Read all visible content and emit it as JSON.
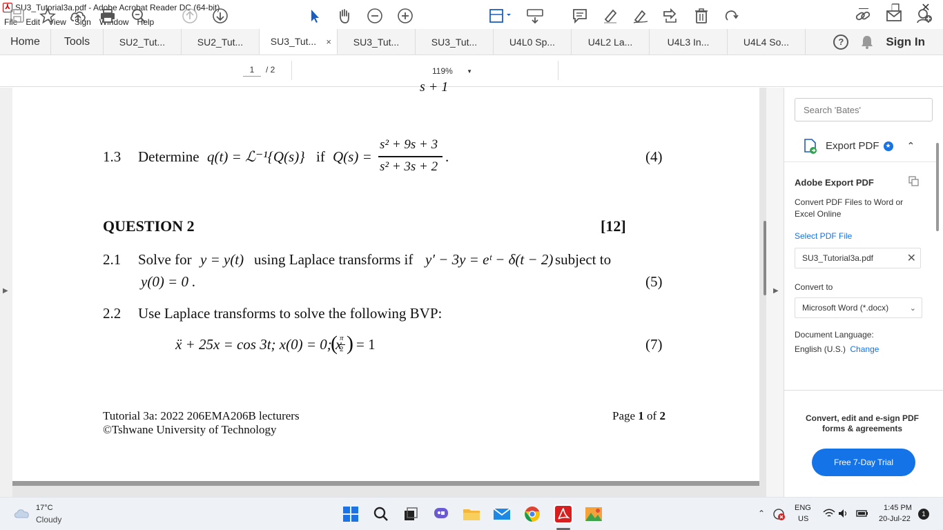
{
  "window": {
    "title": "SU3_Tutorial3a.pdf - Adobe Acrobat Reader DC (64-bit)",
    "icon": "acrobat-icon"
  },
  "menu": [
    "File",
    "Edit",
    "View",
    "Sign",
    "Window",
    "Help"
  ],
  "tabs": {
    "home": "Home",
    "tools": "Tools",
    "docs": [
      "SU2_Tut...",
      "SU2_Tut...",
      "SU3_Tut...",
      "SU3_Tut...",
      "SU3_Tut...",
      "U4L0 Sp...",
      "U4L2 La...",
      "U4L3 In...",
      "U4L4 So..."
    ],
    "active_index": 2,
    "close": "×",
    "sign_in": "Sign In",
    "help": "?"
  },
  "toolbar": {
    "page_current": "1",
    "page_total": "/ 2",
    "zoom": "119%"
  },
  "document": {
    "top_fragment": "s + 1",
    "q13": {
      "num": "1.3",
      "text": "Determine",
      "eq": "q(t) = ℒ⁻¹{Q(s)}",
      "if": "if",
      "lhs": "Q(s) =",
      "numerator": "s² + 9s + 3",
      "denominator": "s² + 3s + 2",
      "end": ".",
      "marks": "(4)"
    },
    "question2": {
      "heading": "QUESTION 2",
      "total": "[12]"
    },
    "q21": {
      "num": "2.1",
      "text": "Solve for",
      "eq1": "y = y(t)",
      "text2": "using Laplace transforms if",
      "eq2": "y′ − 3y = eᵗ − δ(t − 2)",
      "text3": "subject to",
      "line2": "y(0) = 0 .",
      "marks": "(5)"
    },
    "q22": {
      "num": "2.2",
      "text": "Use Laplace transforms to solve the following BVP:",
      "eq": "ẍ + 25x = cos 3t; x(0) = 0; x",
      "eq_paren_num": "π",
      "eq_paren_den": "2",
      "eq_end": "= 1",
      "marks": "(7)"
    },
    "footer": {
      "left1": "Tutorial 3a: 2022 206EMA206B lecturers",
      "left2": "©Tshwane University of Technology",
      "page_prefix": "Page",
      "page_num": "1",
      "page_of": "of",
      "page_total": "2"
    }
  },
  "right_pane": {
    "search_placeholder": "Search 'Bates'",
    "export_title": "Export PDF",
    "section_title": "Adobe Export PDF",
    "description": "Convert PDF Files to Word or Excel Online",
    "select_link": "Select PDF File",
    "file_name": "SU3_Tutorial3a.pdf",
    "convert_to_label": "Convert to",
    "convert_to_value": "Microsoft Word (*.docx)",
    "doc_lang_label": "Document Language:",
    "doc_lang_value": "English (U.S.)",
    "change_link": "Change",
    "promo": "Convert, edit and e-sign PDF forms & agreements",
    "trial_button": "Free 7-Day Trial"
  },
  "taskbar": {
    "weather_temp": "17°C",
    "weather_desc": "Cloudy",
    "lang1": "ENG",
    "lang2": "US",
    "time": "1:45 PM",
    "date": "20-Jul-22",
    "notif_count": "1"
  },
  "colors": {
    "accent_blue": "#1473e6",
    "acrobat_red": "#d71f1f",
    "tab_bg": "#f4f4f4"
  }
}
